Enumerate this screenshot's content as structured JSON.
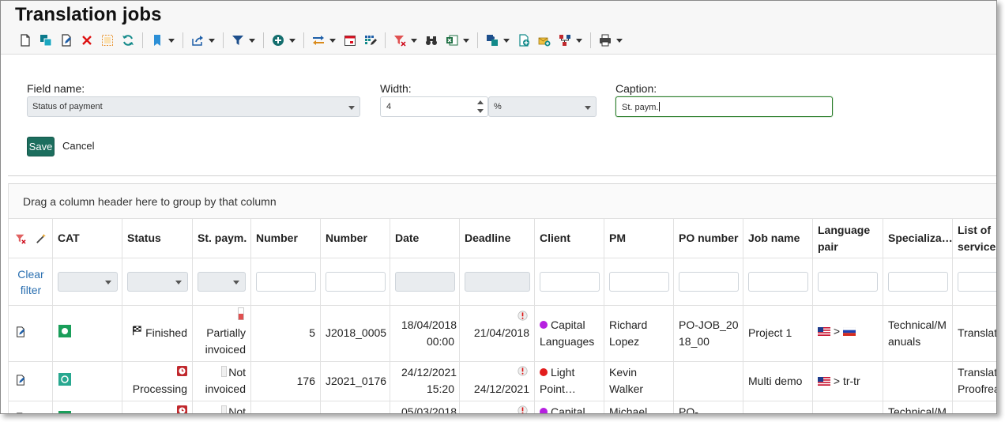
{
  "header": {
    "title": "Translation jobs"
  },
  "colors": {
    "accent": "#1c6e5e",
    "focus_border": "#2a7d2a",
    "link": "#2a6fb0",
    "dot_purple": "#b620e0",
    "dot_red": "#e21d1d"
  },
  "edit": {
    "field_label": "Field name:",
    "field_value": "Status of payment",
    "width_label": "Width:",
    "width_value": "4",
    "unit_value": "%",
    "caption_label": "Caption:",
    "caption_value": "St. paym.",
    "save_label": "Save",
    "cancel_label": "Cancel"
  },
  "grid": {
    "group_hint": "Drag a column header here to group by that column",
    "clear_filter": "Clear filter",
    "columns": {
      "cat": "CAT",
      "status": "Status",
      "stpaym": "St. paym.",
      "number1": "Number",
      "number2": "Number",
      "date": "Date",
      "deadline": "Deadline",
      "client": "Client",
      "pm": "PM",
      "po": "PO number",
      "job": "Job name",
      "lang": "Language pair",
      "spec": "Specializa…",
      "services": "List of services"
    },
    "rows": [
      {
        "status": "Finished",
        "stpaym": "Partially invoiced",
        "number1": "5",
        "number2": "J2018_0005",
        "date": "18/04/2018 00:00",
        "deadline": "21/04/2018",
        "client": "Capital Languages",
        "pm": "Richard Lopez",
        "po": "PO-JOB_2018_00",
        "job": "Project 1",
        "lang": "> ",
        "spec": "Technical/Manuals",
        "services": "Translati"
      },
      {
        "status": "Processing",
        "stpaym": "Not invoiced",
        "number1": "176",
        "number2": "J2021_0176",
        "date": "24/12/2021 15:20",
        "deadline": "24/12/2021",
        "client": "Light Point…",
        "pm": "Kevin Walker",
        "po": "",
        "job": "Multi demo",
        "lang": "> tr-tr",
        "spec": "",
        "services": "Translati Proofrea"
      },
      {
        "status": "",
        "stpaym": "Not",
        "number1": "",
        "number2": "",
        "date": "05/03/2018",
        "deadline": "",
        "client": "Capital",
        "pm": "Michael",
        "po": "PO-",
        "job": "",
        "lang": "",
        "spec": "Technical/M",
        "services": ""
      }
    ]
  }
}
